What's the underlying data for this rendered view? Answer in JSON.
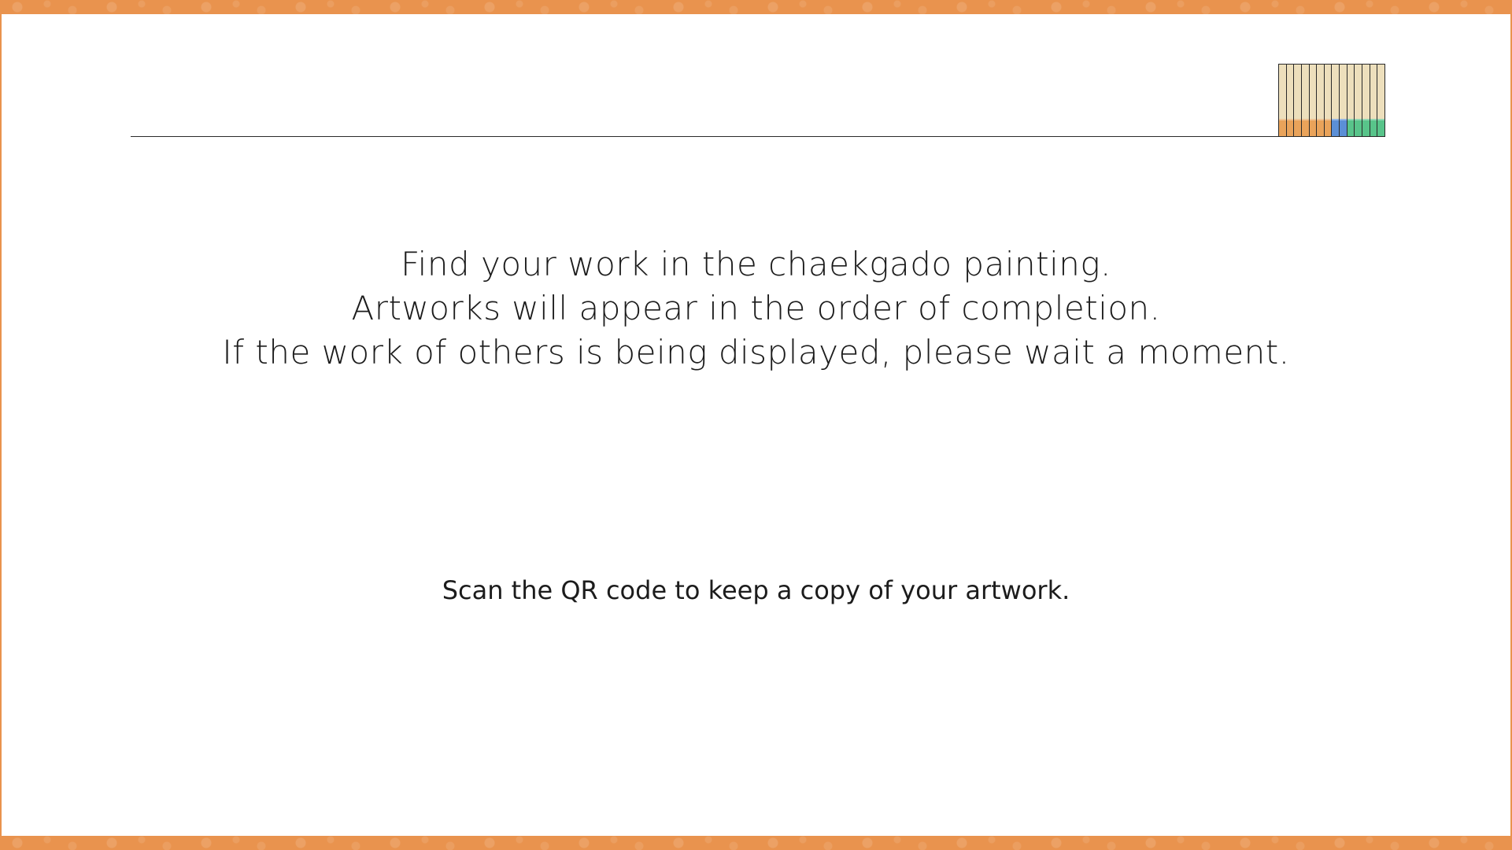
{
  "theme": {
    "accent": "#e9934e",
    "panel_base": "#eddfbc"
  },
  "message": {
    "line1": "Find your work in the chaekgado painting.",
    "line2": "Artworks will appear in the order of completion.",
    "line3": "If the work of others is being displayed, please wait a moment."
  },
  "qr_note": "Scan the QR code to keep a copy of your artwork.",
  "progress_indicator": {
    "slots": [
      {
        "color": "#e9a35a"
      },
      {
        "color": "#e9a35a"
      },
      {
        "color": "#e9a35a"
      },
      {
        "color": "#e9a35a"
      },
      {
        "color": "#e9a35a"
      },
      {
        "color": "#e9a35a"
      },
      {
        "color": "#e9a35a"
      },
      {
        "color": "#5b8fd6"
      },
      {
        "color": "#5b8fd6"
      },
      {
        "color": "#58c48a"
      },
      {
        "color": "#58c48a"
      },
      {
        "color": "#58c48a"
      },
      {
        "color": "#58c48a"
      },
      {
        "color": "#58c48a"
      }
    ]
  }
}
